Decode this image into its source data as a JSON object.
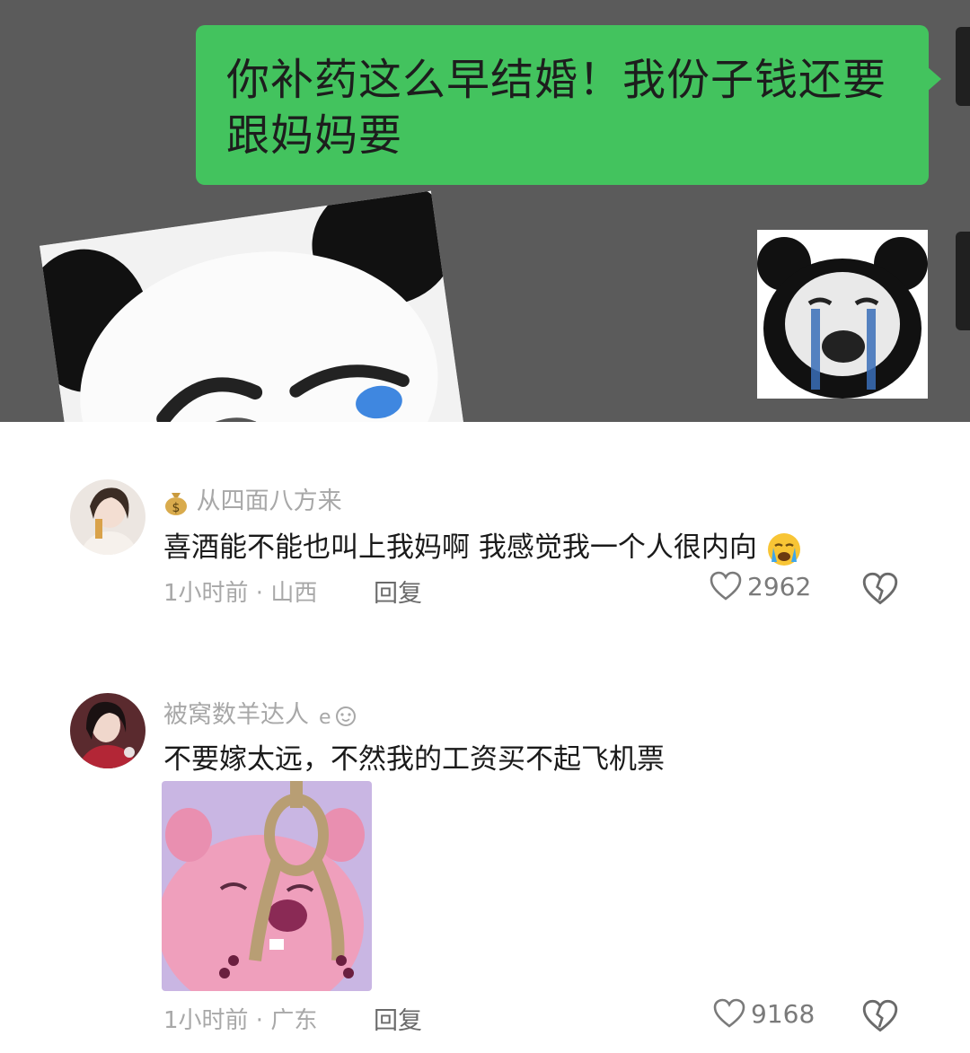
{
  "chat": {
    "message": "你补药这么早结婚！我份子钱还要跟妈妈要",
    "stickers": [
      "crying-panda-sticker",
      "angry-panda-sticker"
    ]
  },
  "comments": [
    {
      "username": "从四面八方来",
      "badge_icon": "money-bag-icon",
      "text": "喜酒能不能也叫上我妈啊  我感觉我一个人很内向",
      "emoji": "crying-face-emoji",
      "time_location": "1小时前 · 山西",
      "reply_label": "回复",
      "likes": "2962"
    },
    {
      "username": "被窝数羊达人",
      "text": "不要嫁太远，不然我的工资买不起飞机票",
      "time_location": "1小时前 · 广东",
      "reply_label": "回复",
      "likes": "9168",
      "image": "pink-beaver-noose-meme"
    }
  ],
  "colors": {
    "chat_background": "#5b5b5b",
    "bubble_green": "#43c35e",
    "meta_gray": "#a8a8a8"
  }
}
